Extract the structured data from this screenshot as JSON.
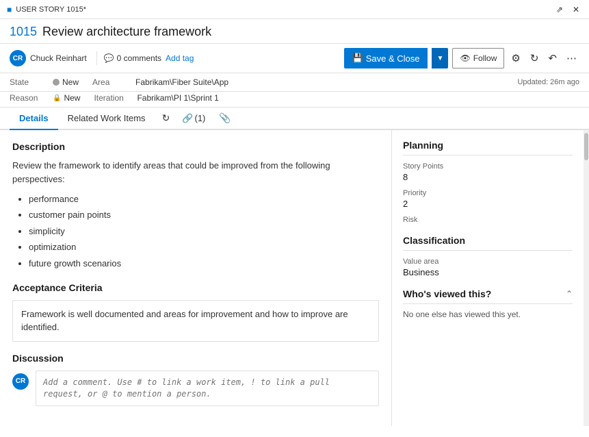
{
  "titlebar": {
    "label": "USER STORY 1015*",
    "expand_title": "expand",
    "close_title": "close"
  },
  "work_item": {
    "id": "1015",
    "title": "Review architecture framework"
  },
  "toolbar": {
    "avatar_initials": "CR",
    "author": "Chuck Reinhart",
    "comments_count": "0 comments",
    "add_tag": "Add tag",
    "save_close": "Save & Close",
    "follow": "Follow",
    "save_icon": "💾"
  },
  "fields": {
    "state_label": "State",
    "state_value": "New",
    "reason_label": "Reason",
    "reason_value": "New",
    "area_label": "Area",
    "area_value": "Fabrikam\\Fiber Suite\\App",
    "iteration_label": "Iteration",
    "iteration_value": "Fabrikam\\PI 1\\Sprint 1",
    "updated": "Updated: 26m ago"
  },
  "tabs": {
    "details": "Details",
    "related_work_items": "Related Work Items",
    "links_count": "(1)",
    "history_icon": "⟳",
    "link_icon": "🔗",
    "attachment_icon": "📎"
  },
  "description": {
    "title": "Description",
    "intro": "Review the framework to identify areas that could be improved from the following perspectives:",
    "bullets": [
      "performance",
      "customer pain points",
      "simplicity",
      "optimization",
      "future growth scenarios"
    ]
  },
  "acceptance": {
    "title": "Acceptance Criteria",
    "text": "Framework is well documented and areas for improvement and how to improve are identified."
  },
  "discussion": {
    "title": "Discussion",
    "placeholder": "Add a comment. Use # to link a work item, ! to link a pull request, or @ to mention a person."
  },
  "planning": {
    "title": "Planning",
    "story_points_label": "Story Points",
    "story_points_value": "8",
    "priority_label": "Priority",
    "priority_value": "2",
    "risk_label": "Risk",
    "risk_value": ""
  },
  "classification": {
    "title": "Classification",
    "value_area_label": "Value area",
    "value_area_value": "Business"
  },
  "whos_viewed": {
    "title": "Who's viewed this?",
    "message": "No one else has viewed this yet."
  }
}
